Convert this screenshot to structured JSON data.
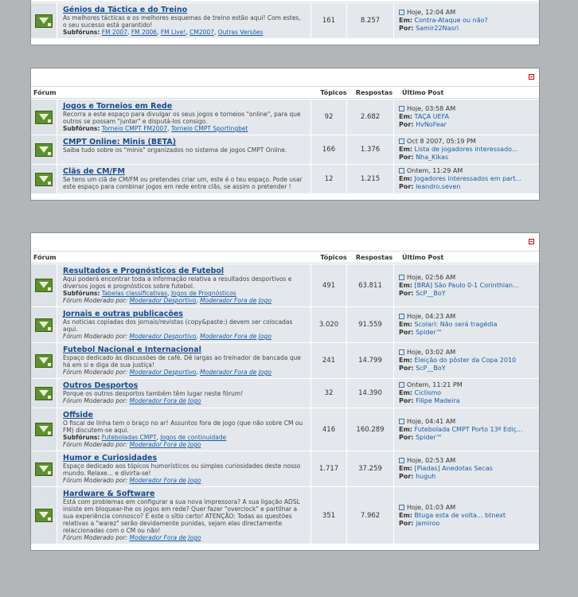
{
  "columns": {
    "forum": "Fórum",
    "topics": "Tópicos",
    "replies": "Respostas",
    "last_post": "Último Post"
  },
  "labels": {
    "subforums": "Subfóruns:",
    "moderated_by": "Fórum Moderado por:",
    "in": "Em:",
    "by": "Por:"
  },
  "sections": [
    {
      "forums": [
        {
          "title": "Génios da Táctica e do Treino",
          "description": "As melhores tácticas e os melhores esquemas de treino estão aqui! Com estes, o seu sucesso está garantido!",
          "subforums": [
            "FM 2007",
            "FM 2006",
            "FM Live!",
            "CM2007",
            "Outras Versões"
          ],
          "moderators": [],
          "topics": "161",
          "replies": "8.257",
          "last": {
            "time": "Hoje, 12:04 AM",
            "in": "Contra-Ataque ou não?",
            "by": "Samir22Nasri"
          }
        }
      ]
    },
    {
      "forums": [
        {
          "title": "Jogos e Torneios em Rede",
          "description": "Recorra a este espaço para divulgar os seus jogos e torneios \"online\", para que outros se possam \"juntar\" e disputá-los consigo.",
          "subforums": [
            "Torneio CMPT FM2007",
            "Torneio CMPT Sportingbet"
          ],
          "moderators": [],
          "topics": "92",
          "replies": "2.682",
          "last": {
            "time": "Hoje, 03:58 AM",
            "in": "TAÇA UEFA",
            "by": "HvNoFear"
          }
        },
        {
          "title": "CMPT Online: Minis (BETA)",
          "description": "Saiba tudo sobre os \"minis\" organizados no sistema de jogos CMPT Online.",
          "subforums": [],
          "moderators": [],
          "topics": "166",
          "replies": "1.376",
          "last": {
            "time": "Oct 8 2007, 05:19 PM",
            "in": "Lista de jogadores interessado...",
            "by": "Nha_Kikas"
          }
        },
        {
          "title": "Clãs de CM/FM",
          "description": "Se tens um clã de CM/FM ou pretendes criar um, este é o teu espaço. Pode usar este espaço para combinar jogos em rede entre clãs, se assim o pretender !",
          "subforums": [],
          "moderators": [],
          "topics": "12",
          "replies": "1.215",
          "last": {
            "time": "Ontem, 11:29 AM",
            "in": "Jogadores interessados em part...",
            "by": "leandro.seven"
          }
        }
      ]
    },
    {
      "forums": [
        {
          "title": "Resultados e Prognósticos de Futebol",
          "description": "Aqui poderá encontrar toda a informação relativa a resultados desportivos e diversos jogos e prognósticos sobre futebol.",
          "subforums": [
            "Tabelas classificativas",
            "Jogos de Prognósticos"
          ],
          "moderators": [
            "Moderador Desportivo",
            "Moderador Fora de Jogo"
          ],
          "topics": "491",
          "replies": "63.811",
          "last": {
            "time": "Hoje, 02:56 AM",
            "in": "[BRA] São Paulo 0-1 Corinthian...",
            "by": "ScP__BoY"
          }
        },
        {
          "title": "Jornais e outras publicações",
          "description": "As noticias copiadas dos jornais/revistas (copy&paste:) devem ser colocadas aqui.",
          "subforums": [],
          "moderators": [
            "Moderador Desportivo",
            "Moderador Fora de Jogo"
          ],
          "topics": "3.020",
          "replies": "91.559",
          "last": {
            "time": "Hoje, 04:23 AM",
            "in": "Scolari: Não será tragédia",
            "by": "Spider™"
          }
        },
        {
          "title": "Futebol Nacional e Internacional",
          "description": "Espaço dedicado às discussões de café. Dê largas ao treinador de bancada que há em si e diga de sua justiça!",
          "subforums": [],
          "moderators": [
            "Moderador Desportivo",
            "Moderador Fora de Jogo"
          ],
          "topics": "241",
          "replies": "14.799",
          "last": {
            "time": "Hoje, 03:02 AM",
            "in": "Eleição do pôster da Copa 2010",
            "by": "ScP__BoY"
          }
        },
        {
          "title": "Outros Desportos",
          "description": "Porque os outros desportos também têm lugar neste fórum!",
          "subforums": [],
          "moderators": [
            "Moderador Fora de Jogo"
          ],
          "topics": "32",
          "replies": "14.390",
          "last": {
            "time": "Ontem, 11:21 PM",
            "in": "Ciclismo",
            "by": "Filipe Madeira"
          }
        },
        {
          "title": "Offside",
          "description": "O fiscal de linha tem o braço no ar! Assuntos fora de jogo (que não sobre CM ou FM) discutem-se aqui.",
          "subforums": [
            "Futeboladas CMPT",
            "Jogos de continuidade"
          ],
          "moderators": [
            "Moderador Fora de Jogo"
          ],
          "topics": "416",
          "replies": "160.289",
          "last": {
            "time": "Hoje, 04:41 AM",
            "in": "Futebolada CMPT Porto 13ª Ediç...",
            "by": "Spider™"
          }
        },
        {
          "title": "Humor e Curiosidades",
          "description": "Espaço dedicado aos tópicos humorísticos ou simples curiosidades deste nosso mundo. Relaxe... e divirta-se!",
          "subforums": [],
          "moderators": [
            "Moderador Fora de Jogo"
          ],
          "topics": "1.717",
          "replies": "37.259",
          "last": {
            "time": "Hoje, 02:53 AM",
            "in": "[Piadas] Anedotas Secas",
            "by": "huguh"
          }
        },
        {
          "title": "Hardware & Software",
          "description": "Está com problemas em configurar a sua nova impressora? A sua ligação ADSL insiste em bloquear-lhe os jogos em rede? Quer fazer \"overclock\" e partilhar a sua experiência connosco? É este o sítio certo! ATENÇÃO: Todas as questões relativas a \"warez\" serão devidamente punidas, sejam elas directamente relaccionadas com o CM ou não!",
          "subforums": [],
          "moderators": [
            "Moderador Fora de Jogo"
          ],
          "topics": "351",
          "replies": "7.962",
          "last": {
            "time": "Hoje, 01:03 AM",
            "in": "Btuga esta de volta... btnext",
            "by": "jamiroo"
          }
        }
      ]
    }
  ]
}
